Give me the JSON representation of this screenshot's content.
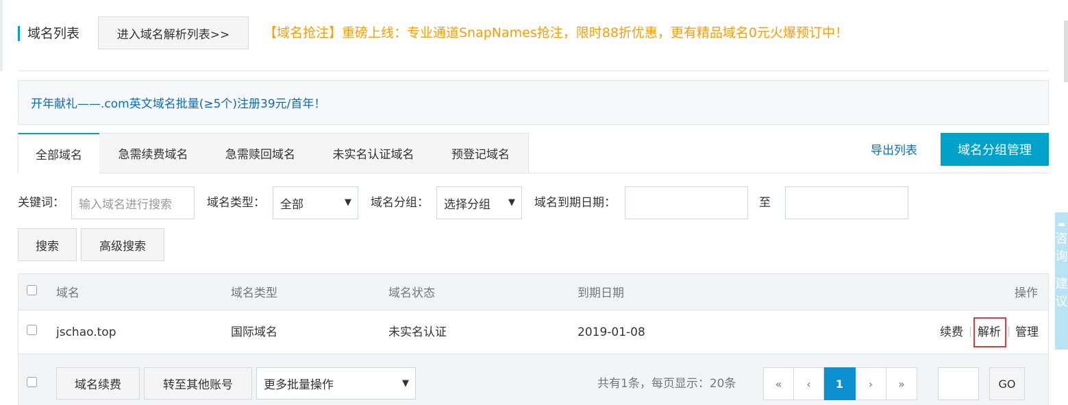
{
  "header": {
    "title": "域名列表",
    "enter_dns_button": "进入域名解析列表>>",
    "promo": "【域名抢注】重磅上线：专业通道SnapNames抢注，限时88折优惠，更有精品域名0元火爆预订中！"
  },
  "notice": {
    "text": "开年献礼——.com英文域名批量(≥5个)注册39元/首年！"
  },
  "tabs": [
    {
      "label": "全部域名"
    },
    {
      "label": "急需续费域名"
    },
    {
      "label": "急需赎回域名"
    },
    {
      "label": "未实名认证域名"
    },
    {
      "label": "预登记域名"
    }
  ],
  "actions": {
    "export_list": "导出列表",
    "group_manage": "域名分组管理"
  },
  "filters": {
    "keyword_label": "关键词：",
    "keyword_placeholder": "输入域名进行搜索",
    "type_label": "域名类型：",
    "type_value": "全部",
    "group_label": "域名分组：",
    "group_value": "选择分组",
    "expiry_label": "域名到期日期：",
    "to_label": "至",
    "search_button": "搜索",
    "advanced_search_button": "高级搜索"
  },
  "table": {
    "headers": [
      "域名",
      "域名类型",
      "域名状态",
      "到期日期",
      "操作"
    ],
    "rows": [
      {
        "domain": "jschao.top",
        "type": "国际域名",
        "status": "未实名认证",
        "expiry": "2019-01-08",
        "ops": [
          "续费",
          "解析",
          "管理"
        ]
      }
    ]
  },
  "footer": {
    "renew_button": "域名续费",
    "transfer_button": "转至其他账号",
    "batch_select": "更多批量操作",
    "summary": "共有1条，每页显示：20条",
    "pager": [
      "«",
      "‹",
      "1",
      "›",
      "»"
    ],
    "go_button": "GO"
  },
  "side_float": {
    "chars": [
      "咨",
      "询",
      "建",
      "议"
    ]
  },
  "colors": {
    "accent": "#00a2ca",
    "link": "#0b6bbd",
    "promo": "#ff9c00",
    "highlight": "#e4393c"
  }
}
